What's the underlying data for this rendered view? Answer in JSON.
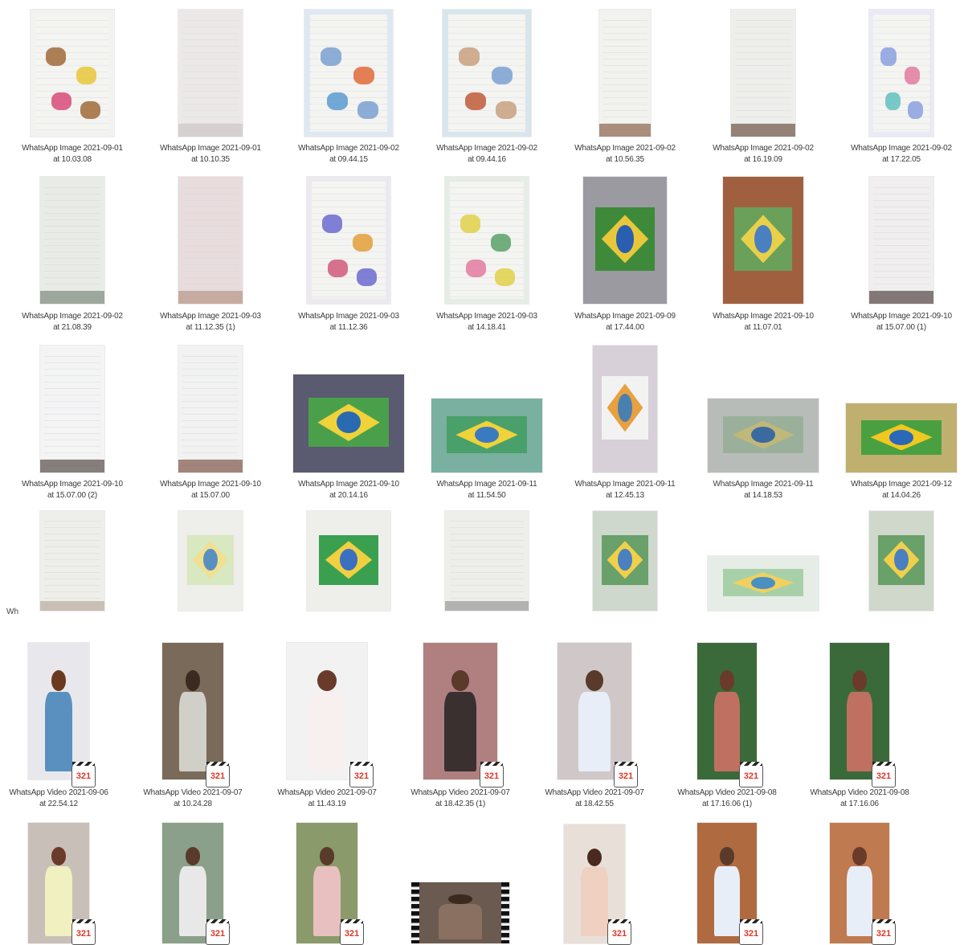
{
  "folder_items": [
    {
      "name_l1": "WhatsApp Image 2021-09-01",
      "name_l2": "at 10.03.08",
      "kind": "drawing",
      "colors": [
        "#f2f2ee",
        "#a06a3a",
        "#e8c63a",
        "#d84a7a"
      ]
    },
    {
      "name_l1": "WhatsApp Image 2021-09-01",
      "name_l2": "at 10.10.35",
      "kind": "page",
      "colors": [
        "#ece8e8",
        "#c9c0c0"
      ]
    },
    {
      "name_l1": "WhatsApp Image 2021-09-02",
      "name_l2": "at 09.44.15",
      "kind": "drawing",
      "colors": [
        "#dfe8f2",
        "#7aa0d2",
        "#e06a3a",
        "#5a9ad0"
      ]
    },
    {
      "name_l1": "WhatsApp Image 2021-09-02",
      "name_l2": "at 09.44.16",
      "kind": "drawing",
      "colors": [
        "#d8e6ec",
        "#c8a080",
        "#7aa0d2",
        "#c05a3a"
      ]
    },
    {
      "name_l1": "WhatsApp Image 2021-09-02",
      "name_l2": "at 10.56.35",
      "kind": "page",
      "colors": [
        "#f2f2ee",
        "#7a4a30"
      ]
    },
    {
      "name_l1": "WhatsApp Image 2021-09-02",
      "name_l2": "at 16.19.09",
      "kind": "page",
      "colors": [
        "#eeeeea",
        "#5a3a2a"
      ]
    },
    {
      "name_l1": "WhatsApp Image 2021-09-02",
      "name_l2": "at 17.22.05",
      "kind": "drawing",
      "colors": [
        "#eaeaf6",
        "#8aa0e0",
        "#e07aa0",
        "#60c0c0"
      ]
    },
    {
      "name_l1": "WhatsApp Image 2021-09-02",
      "name_l2": "at 21.08.39",
      "kind": "page",
      "colors": [
        "#e9ebe6",
        "#6a7a6a"
      ]
    },
    {
      "name_l1": "WhatsApp Image 2021-09-03",
      "name_l2": "at 11.12.35 (1)",
      "kind": "page",
      "colors": [
        "#e8dcdc",
        "#b08a7a"
      ]
    },
    {
      "name_l1": "WhatsApp Image 2021-09-03",
      "name_l2": "at 11.12.36",
      "kind": "drawing",
      "colors": [
        "#eceaf0",
        "#6a6ad0",
        "#e0a03a",
        "#d05a7a"
      ]
    },
    {
      "name_l1": "WhatsApp Image 2021-09-03",
      "name_l2": "at 14.18.41",
      "kind": "drawing",
      "colors": [
        "#e6ece6",
        "#e0d04a",
        "#5aa06a",
        "#e07aa0"
      ]
    },
    {
      "name_l1": "WhatsApp Image 2021-09-09",
      "name_l2": "at 17.44.00",
      "kind": "flag",
      "colors": [
        "#9a9aa0",
        "#3f8a3a",
        "#e8c83a",
        "#2a5fb0"
      ]
    },
    {
      "name_l1": "WhatsApp Image 2021-09-10",
      "name_l2": "at 11.07.01",
      "kind": "flag",
      "colors": [
        "#a06040",
        "#6aa05a",
        "#e8d04a",
        "#4a80c0"
      ]
    },
    {
      "name_l1": "WhatsApp Image 2021-09-10",
      "name_l2": "at 15.07.00 (1)",
      "kind": "page",
      "colors": [
        "#f0eeee",
        "#3a2a2a"
      ]
    },
    {
      "name_l1": "WhatsApp Image 2021-09-10",
      "name_l2": "at 15.07.00 (2)",
      "kind": "page",
      "colors": [
        "#f4f4f4",
        "#3a2e2a"
      ]
    },
    {
      "name_l1": "WhatsApp Image 2021-09-10",
      "name_l2": "at 15.07.00",
      "kind": "page",
      "colors": [
        "#f2f2f2",
        "#6a3a2a"
      ]
    },
    {
      "name_l1": "WhatsApp Image 2021-09-10",
      "name_l2": "at 20.14.16",
      "kind": "flag",
      "colors": [
        "#5a5a70",
        "#4aa04a",
        "#f0d23a",
        "#2a6ab0"
      ]
    },
    {
      "name_l1": "WhatsApp Image 2021-09-11",
      "name_l2": "at 11.54.50",
      "kind": "flag",
      "colors": [
        "#7ab0a0",
        "#4aa06a",
        "#f0d23a",
        "#3a7ac0"
      ]
    },
    {
      "name_l1": "WhatsApp Image 2021-09-11",
      "name_l2": "at 12.45.13",
      "kind": "flag",
      "colors": [
        "#d8d0d8",
        "#f2f2f2",
        "#e8a040",
        "#4a80b0"
      ]
    },
    {
      "name_l1": "WhatsApp Image 2021-09-11",
      "name_l2": "at 14.18.53",
      "kind": "flag",
      "colors": [
        "#b8bcb8",
        "#9ab09a",
        "#c0b878",
        "#3a6aa0"
      ]
    },
    {
      "name_l1": "WhatsApp Image 2021-09-12",
      "name_l2": "at 14.04.26",
      "kind": "flag",
      "colors": [
        "#c0b070",
        "#4aa040",
        "#f0c820",
        "#2a68b8"
      ]
    },
    {
      "name_l1": "Wh",
      "name_l2": "",
      "kind": "page",
      "colors": [
        "#eeeeea",
        "#b0a090"
      ]
    },
    {
      "name_l1": "",
      "name_l2": "",
      "kind": "flag",
      "colors": [
        "#eeeeea",
        "#d8e8c0",
        "#f0e090",
        "#5a90c0"
      ]
    },
    {
      "name_l1": "",
      "name_l2": "",
      "kind": "flag",
      "colors": [
        "#eeeeea",
        "#3aa050",
        "#f0d040",
        "#3a70c0"
      ]
    },
    {
      "name_l1": "",
      "name_l2": "",
      "kind": "page",
      "colors": [
        "#eeeeea",
        "#8a8a8a"
      ]
    },
    {
      "name_l1": "",
      "name_l2": "",
      "kind": "flag",
      "colors": [
        "#cfd8cc",
        "#6aa06a",
        "#f0d04a",
        "#4a80c0"
      ]
    },
    {
      "name_l1": "",
      "name_l2": "",
      "kind": "flag",
      "colors": [
        "#e6ece6",
        "#a8d0a8",
        "#f0d060",
        "#4a90c0"
      ]
    },
    {
      "name_l1": "",
      "name_l2": "",
      "kind": "flag",
      "colors": [
        "#d0d8cc",
        "#6aa06a",
        "#f0d04a",
        "#4a80c0"
      ]
    },
    {
      "name_l1": "WhatsApp Video 2021-09-06",
      "name_l2": "at 22.54.12",
      "kind": "video",
      "colors": [
        "#e8e8ec",
        "#5a90c0",
        "#6a3a20"
      ]
    },
    {
      "name_l1": "WhatsApp Video 2021-09-07",
      "name_l2": "at 10.24.28",
      "kind": "video",
      "colors": [
        "#7a6a5a",
        "#d0d0c8",
        "#3a2a20"
      ]
    },
    {
      "name_l1": "WhatsApp Video 2021-09-07",
      "name_l2": "at 11.43.19",
      "kind": "video",
      "colors": [
        "#f2f2f2",
        "#f8f0ee",
        "#6a3a2a"
      ]
    },
    {
      "name_l1": "WhatsApp Video 2021-09-07",
      "name_l2": "at 18.42.35 (1)",
      "kind": "video",
      "colors": [
        "#b08080",
        "#3a3030",
        "#5a3a2a"
      ]
    },
    {
      "name_l1": "WhatsApp Video 2021-09-07",
      "name_l2": "at 18.42.55",
      "kind": "video",
      "colors": [
        "#d0c8c8",
        "#e8eef8",
        "#5a3a2a"
      ]
    },
    {
      "name_l1": "WhatsApp Video 2021-09-08",
      "name_l2": "at 17.16.06 (1)",
      "kind": "video",
      "colors": [
        "#3a6a3a",
        "#c07060",
        "#6a3a2a"
      ]
    },
    {
      "name_l1": "WhatsApp Video 2021-09-08",
      "name_l2": "at 17.16.06",
      "kind": "video",
      "colors": [
        "#3a6a3a",
        "#c07060",
        "#6a3a2a"
      ]
    },
    {
      "name_l1": "",
      "name_l2": "",
      "kind": "video",
      "colors": [
        "#c8c0b8",
        "#f0f0c0",
        "#6a3a2a"
      ]
    },
    {
      "name_l1": "",
      "name_l2": "",
      "kind": "video",
      "colors": [
        "#8aa08a",
        "#e8e8e8",
        "#5a3a2a"
      ]
    },
    {
      "name_l1": "",
      "name_l2": "",
      "kind": "video",
      "colors": [
        "#8a9a6a",
        "#e8c0c0",
        "#5a3a2a"
      ]
    },
    {
      "name_l1": "",
      "name_l2": "",
      "kind": "film",
      "colors": [
        "#6a5a50",
        "#8a7060",
        "#3a2a20"
      ]
    },
    {
      "name_l1": "",
      "name_l2": "",
      "kind": "video",
      "colors": [
        "#e8e0d8",
        "#f0d0c0",
        "#4a2a20"
      ]
    },
    {
      "name_l1": "",
      "name_l2": "",
      "kind": "video",
      "colors": [
        "#b06a40",
        "#e8eef8",
        "#5a3a2a"
      ]
    },
    {
      "name_l1": "",
      "name_l2": "",
      "kind": "video",
      "colors": [
        "#c07a50",
        "#e8eef8",
        "#6a3a2a"
      ]
    }
  ],
  "video_badge_label": "321",
  "truncated_label": "Wh"
}
